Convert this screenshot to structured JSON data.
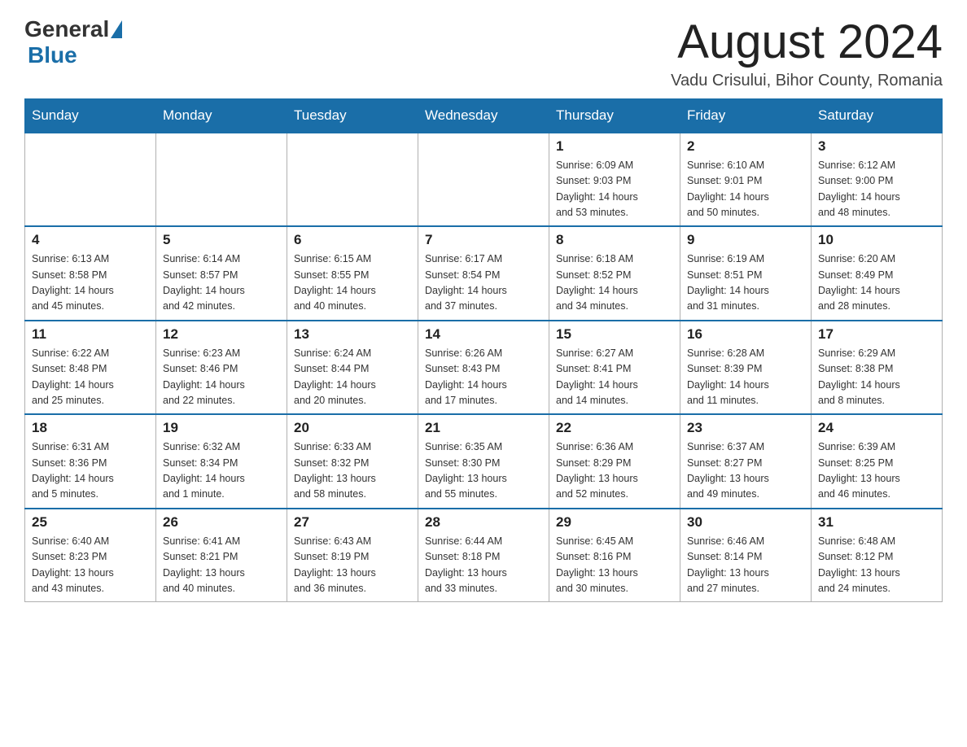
{
  "header": {
    "logo_general": "General",
    "logo_blue": "Blue",
    "month_title": "August 2024",
    "location": "Vadu Crisului, Bihor County, Romania"
  },
  "days_of_week": [
    "Sunday",
    "Monday",
    "Tuesday",
    "Wednesday",
    "Thursday",
    "Friday",
    "Saturday"
  ],
  "weeks": [
    [
      {
        "day": "",
        "info": ""
      },
      {
        "day": "",
        "info": ""
      },
      {
        "day": "",
        "info": ""
      },
      {
        "day": "",
        "info": ""
      },
      {
        "day": "1",
        "info": "Sunrise: 6:09 AM\nSunset: 9:03 PM\nDaylight: 14 hours\nand 53 minutes."
      },
      {
        "day": "2",
        "info": "Sunrise: 6:10 AM\nSunset: 9:01 PM\nDaylight: 14 hours\nand 50 minutes."
      },
      {
        "day": "3",
        "info": "Sunrise: 6:12 AM\nSunset: 9:00 PM\nDaylight: 14 hours\nand 48 minutes."
      }
    ],
    [
      {
        "day": "4",
        "info": "Sunrise: 6:13 AM\nSunset: 8:58 PM\nDaylight: 14 hours\nand 45 minutes."
      },
      {
        "day": "5",
        "info": "Sunrise: 6:14 AM\nSunset: 8:57 PM\nDaylight: 14 hours\nand 42 minutes."
      },
      {
        "day": "6",
        "info": "Sunrise: 6:15 AM\nSunset: 8:55 PM\nDaylight: 14 hours\nand 40 minutes."
      },
      {
        "day": "7",
        "info": "Sunrise: 6:17 AM\nSunset: 8:54 PM\nDaylight: 14 hours\nand 37 minutes."
      },
      {
        "day": "8",
        "info": "Sunrise: 6:18 AM\nSunset: 8:52 PM\nDaylight: 14 hours\nand 34 minutes."
      },
      {
        "day": "9",
        "info": "Sunrise: 6:19 AM\nSunset: 8:51 PM\nDaylight: 14 hours\nand 31 minutes."
      },
      {
        "day": "10",
        "info": "Sunrise: 6:20 AM\nSunset: 8:49 PM\nDaylight: 14 hours\nand 28 minutes."
      }
    ],
    [
      {
        "day": "11",
        "info": "Sunrise: 6:22 AM\nSunset: 8:48 PM\nDaylight: 14 hours\nand 25 minutes."
      },
      {
        "day": "12",
        "info": "Sunrise: 6:23 AM\nSunset: 8:46 PM\nDaylight: 14 hours\nand 22 minutes."
      },
      {
        "day": "13",
        "info": "Sunrise: 6:24 AM\nSunset: 8:44 PM\nDaylight: 14 hours\nand 20 minutes."
      },
      {
        "day": "14",
        "info": "Sunrise: 6:26 AM\nSunset: 8:43 PM\nDaylight: 14 hours\nand 17 minutes."
      },
      {
        "day": "15",
        "info": "Sunrise: 6:27 AM\nSunset: 8:41 PM\nDaylight: 14 hours\nand 14 minutes."
      },
      {
        "day": "16",
        "info": "Sunrise: 6:28 AM\nSunset: 8:39 PM\nDaylight: 14 hours\nand 11 minutes."
      },
      {
        "day": "17",
        "info": "Sunrise: 6:29 AM\nSunset: 8:38 PM\nDaylight: 14 hours\nand 8 minutes."
      }
    ],
    [
      {
        "day": "18",
        "info": "Sunrise: 6:31 AM\nSunset: 8:36 PM\nDaylight: 14 hours\nand 5 minutes."
      },
      {
        "day": "19",
        "info": "Sunrise: 6:32 AM\nSunset: 8:34 PM\nDaylight: 14 hours\nand 1 minute."
      },
      {
        "day": "20",
        "info": "Sunrise: 6:33 AM\nSunset: 8:32 PM\nDaylight: 13 hours\nand 58 minutes."
      },
      {
        "day": "21",
        "info": "Sunrise: 6:35 AM\nSunset: 8:30 PM\nDaylight: 13 hours\nand 55 minutes."
      },
      {
        "day": "22",
        "info": "Sunrise: 6:36 AM\nSunset: 8:29 PM\nDaylight: 13 hours\nand 52 minutes."
      },
      {
        "day": "23",
        "info": "Sunrise: 6:37 AM\nSunset: 8:27 PM\nDaylight: 13 hours\nand 49 minutes."
      },
      {
        "day": "24",
        "info": "Sunrise: 6:39 AM\nSunset: 8:25 PM\nDaylight: 13 hours\nand 46 minutes."
      }
    ],
    [
      {
        "day": "25",
        "info": "Sunrise: 6:40 AM\nSunset: 8:23 PM\nDaylight: 13 hours\nand 43 minutes."
      },
      {
        "day": "26",
        "info": "Sunrise: 6:41 AM\nSunset: 8:21 PM\nDaylight: 13 hours\nand 40 minutes."
      },
      {
        "day": "27",
        "info": "Sunrise: 6:43 AM\nSunset: 8:19 PM\nDaylight: 13 hours\nand 36 minutes."
      },
      {
        "day": "28",
        "info": "Sunrise: 6:44 AM\nSunset: 8:18 PM\nDaylight: 13 hours\nand 33 minutes."
      },
      {
        "day": "29",
        "info": "Sunrise: 6:45 AM\nSunset: 8:16 PM\nDaylight: 13 hours\nand 30 minutes."
      },
      {
        "day": "30",
        "info": "Sunrise: 6:46 AM\nSunset: 8:14 PM\nDaylight: 13 hours\nand 27 minutes."
      },
      {
        "day": "31",
        "info": "Sunrise: 6:48 AM\nSunset: 8:12 PM\nDaylight: 13 hours\nand 24 minutes."
      }
    ]
  ]
}
